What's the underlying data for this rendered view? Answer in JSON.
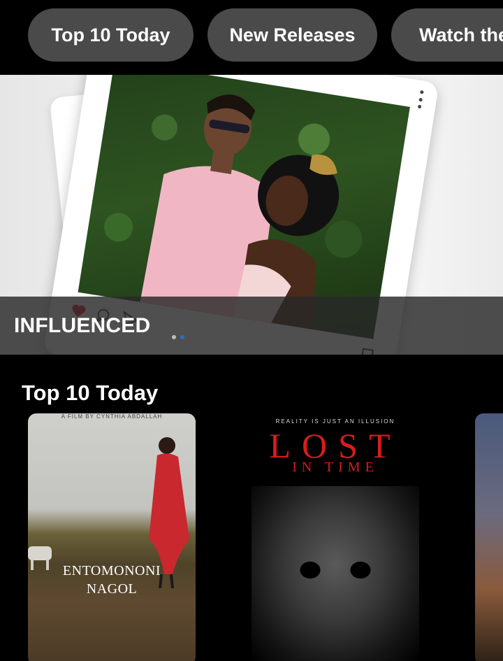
{
  "chips": [
    "Top 10 Today",
    "New Releases",
    "Watch the"
  ],
  "hero": {
    "title": "INFLUENCED",
    "page_count": 2,
    "active_page": 2
  },
  "section": {
    "heading": "Top 10 Today"
  },
  "posters": [
    {
      "credit": "A FILM BY CYNTHIA ABDALLAH",
      "title_line1": "ENTOMONONI",
      "title_line2": "NAGOL"
    },
    {
      "tagline": "REALITY IS JUST AN ILLUSION",
      "title": "LOST",
      "subtitle": "IN TIME"
    },
    {}
  ],
  "colors": {
    "background": "#000000",
    "chip": "#4a4a4a",
    "banner": "#282828",
    "lost_red": "#d91c1c",
    "pager_active": "#2a6fbf"
  }
}
